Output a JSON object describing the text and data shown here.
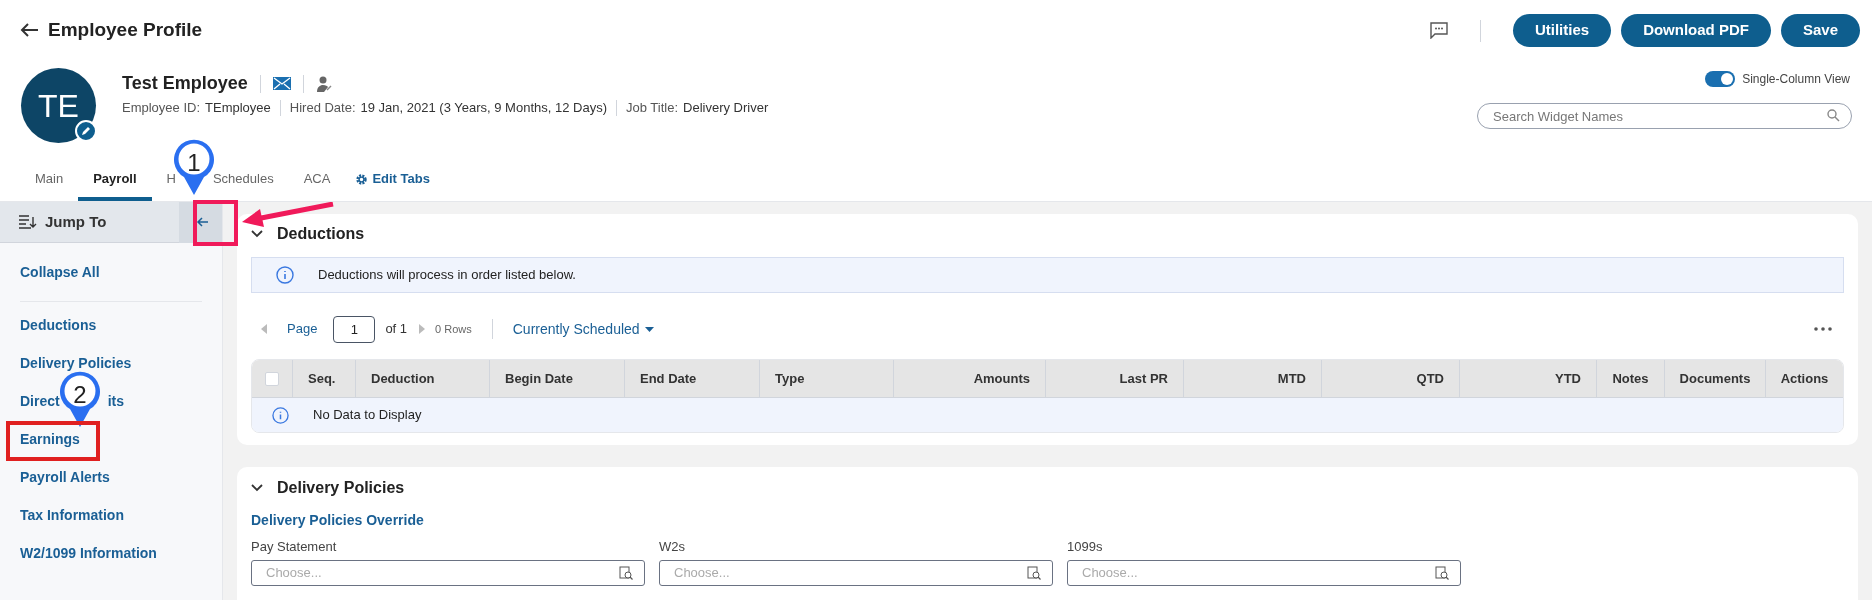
{
  "page_title": "Employee Profile",
  "header_buttons": [
    "Utilities",
    "Download PDF",
    "Save"
  ],
  "employee": {
    "initials": "TE",
    "name": "Test Employee",
    "fields": [
      {
        "label": "Employee ID:",
        "value": "TEmployee"
      },
      {
        "label": "Hired Date:",
        "value": "19 Jan, 2021 (3 Years, 9 Months, 12 Days)"
      },
      {
        "label": "Job Title:",
        "value": "Delivery Driver"
      }
    ]
  },
  "single_column_view": {
    "label": "Single-Column View",
    "on": true
  },
  "widget_search": {
    "placeholder": "Search Widget Names"
  },
  "tabs": [
    {
      "label": "Main",
      "selected": false
    },
    {
      "label": "Payroll",
      "selected": true
    },
    {
      "label": "H",
      "selected": false
    },
    {
      "label": "Schedules",
      "selected": false
    },
    {
      "label": "ACA",
      "selected": false
    }
  ],
  "edit_tabs": "Edit Tabs",
  "jump_to": {
    "title": "Jump To",
    "collapse_all": "Collapse All",
    "items": [
      {
        "text": "Deductions"
      },
      {
        "text": "Delivery Policies"
      },
      {
        "text": "Direct",
        "tail": "its"
      },
      {
        "text": "Earnings"
      },
      {
        "text": "Payroll Alerts"
      },
      {
        "text": "Tax Information"
      },
      {
        "text": "W2/1099 Information"
      }
    ]
  },
  "deductions": {
    "title": "Deductions",
    "note": "Deductions will process in order listed below.",
    "pager": {
      "label": "Page",
      "page": "1",
      "of": "of 1",
      "rows": "0 Rows"
    },
    "filter": "Currently Scheduled",
    "select_all_checked": false,
    "columns": [
      "Seq.",
      "Deduction",
      "Begin Date",
      "End Date",
      "Type",
      "Amounts",
      "Last PR",
      "MTD",
      "QTD",
      "YTD",
      "Notes",
      "Documents",
      "Actions"
    ],
    "empty": "No Data to Display"
  },
  "delivery_policies": {
    "title": "Delivery Policies",
    "override_link": "Delivery Policies Override",
    "fields": [
      {
        "label": "Pay Statement",
        "placeholder": "Choose..."
      },
      {
        "label": "W2s",
        "placeholder": "Choose..."
      },
      {
        "label": "1099s",
        "placeholder": "Choose..."
      }
    ]
  },
  "annotations": [
    {
      "label": "1"
    },
    {
      "label": "2"
    }
  ]
}
